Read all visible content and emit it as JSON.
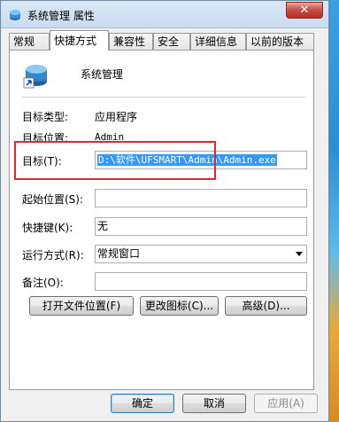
{
  "window": {
    "title": "系统管理 属性",
    "close_label": "✕"
  },
  "tabs": [
    {
      "label": "常规",
      "active": false
    },
    {
      "label": "快捷方式",
      "active": true
    },
    {
      "label": "兼容性",
      "active": false
    },
    {
      "label": "安全",
      "active": false
    },
    {
      "label": "详细信息",
      "active": false
    },
    {
      "label": "以前的版本",
      "active": false
    }
  ],
  "shortcut": {
    "name": "系统管理",
    "target_type_label": "目标类型:",
    "target_type_value": "应用程序",
    "target_location_label": "目标位置:",
    "target_location_value": "Admin",
    "target_label": "目标(T):",
    "target_value": "D:\\软件\\UFSMART\\Admin\\Admin.exe",
    "start_in_label": "起始位置(S):",
    "start_in_value": "",
    "shortcut_key_label": "快捷键(K):",
    "shortcut_key_value": "无",
    "run_label": "运行方式(R):",
    "run_value": "常规窗口",
    "comment_label": "备注(O):",
    "comment_value": ""
  },
  "buttons": {
    "open_location": "打开文件位置(F)",
    "change_icon": "更改图标(C)...",
    "advanced": "高级(D)...",
    "ok": "确定",
    "cancel": "取消",
    "apply": "应用(A)"
  },
  "colors": {
    "highlight_box": "#e0282e",
    "selection": "#3399ff"
  }
}
